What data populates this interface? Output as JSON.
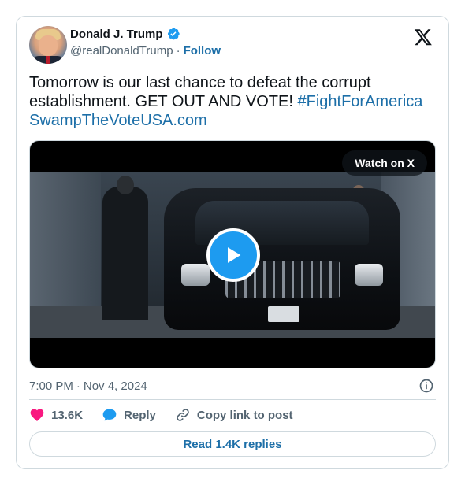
{
  "author": {
    "name": "Donald J. Trump",
    "handle": "@realDonaldTrump",
    "separator": "·",
    "follow_label": "Follow"
  },
  "tweet": {
    "text": "Tomorrow is our last chance to defeat the corrupt establishment. GET OUT AND VOTE!",
    "hashtag": "#FightForAmerica",
    "link": "SwampTheVoteUSA.com"
  },
  "media": {
    "watch_label": "Watch on X"
  },
  "meta": {
    "time": "7:00 PM",
    "separator": "·",
    "date": "Nov 4, 2024"
  },
  "actions": {
    "likes": "13.6K",
    "reply_label": "Reply",
    "copy_label": "Copy link to post"
  },
  "footer": {
    "read_replies_label": "Read 1.4K replies"
  },
  "colors": {
    "link": "#1d6fa8",
    "verified": "#1d9bf0",
    "like": "#f91880",
    "reply": "#1d9bf0",
    "muted": "#536471",
    "border": "#cfd9de"
  },
  "icons": {
    "verified": "verified-badge-icon",
    "logo": "x-logo-icon",
    "play": "play-icon",
    "info": "info-icon",
    "like": "heart-icon",
    "reply": "reply-bubble-icon",
    "copy": "link-icon"
  }
}
